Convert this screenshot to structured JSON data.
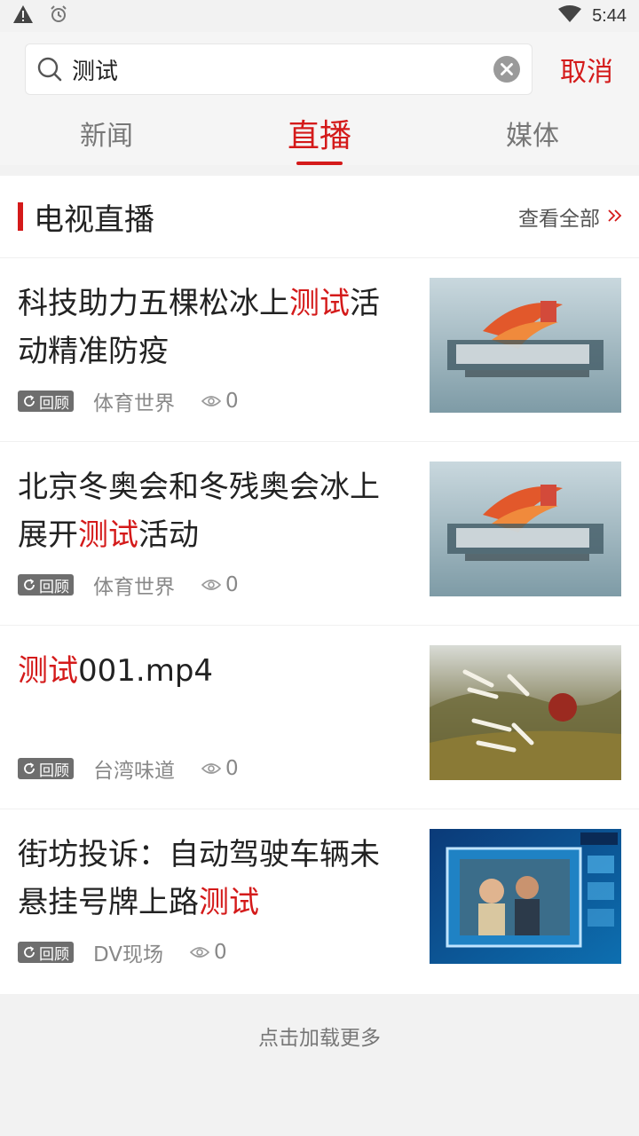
{
  "status_bar": {
    "time": "5:44",
    "icons": [
      "warning-icon",
      "alarm-icon",
      "wifi-icon",
      "battery-icon"
    ]
  },
  "search": {
    "value": "测试",
    "placeholder": "",
    "cancel_label": "取消"
  },
  "tabs": [
    {
      "label": "新闻",
      "active": false
    },
    {
      "label": "直播",
      "active": true
    },
    {
      "label": "媒体",
      "active": false
    }
  ],
  "section": {
    "title": "电视直播",
    "view_all_label": "查看全部"
  },
  "items": [
    {
      "title_before": "科技助力五棵松冰上",
      "highlight": "测试",
      "title_after": "活动精准防疫",
      "badge": "回顾",
      "channel": "体育世界",
      "views": "0",
      "thumb": "sports-world-logo"
    },
    {
      "title_before": "北京冬奥会和冬残奥会冰上展开",
      "highlight": "测试",
      "title_after": "活动",
      "badge": "回顾",
      "channel": "体育世界",
      "views": "0",
      "thumb": "sports-world-logo"
    },
    {
      "title_before": "",
      "highlight": "测试",
      "title_after": "001.mp4",
      "badge": "回顾",
      "channel": "台湾味道",
      "views": "0",
      "thumb": "taiwan-flavor-landscape"
    },
    {
      "title_before": "街坊投诉：自动驾驶车辆未悬挂号牌上路",
      "highlight": "测试",
      "title_after": "",
      "badge": "回顾",
      "channel": "DV现场",
      "views": "0",
      "thumb": "news-studio-screen"
    }
  ],
  "load_more_label": "点击加载更多",
  "colors": {
    "accent": "#d41a1a",
    "badge_bg": "#6e6e6e",
    "page_bg": "#f2f2f2"
  }
}
